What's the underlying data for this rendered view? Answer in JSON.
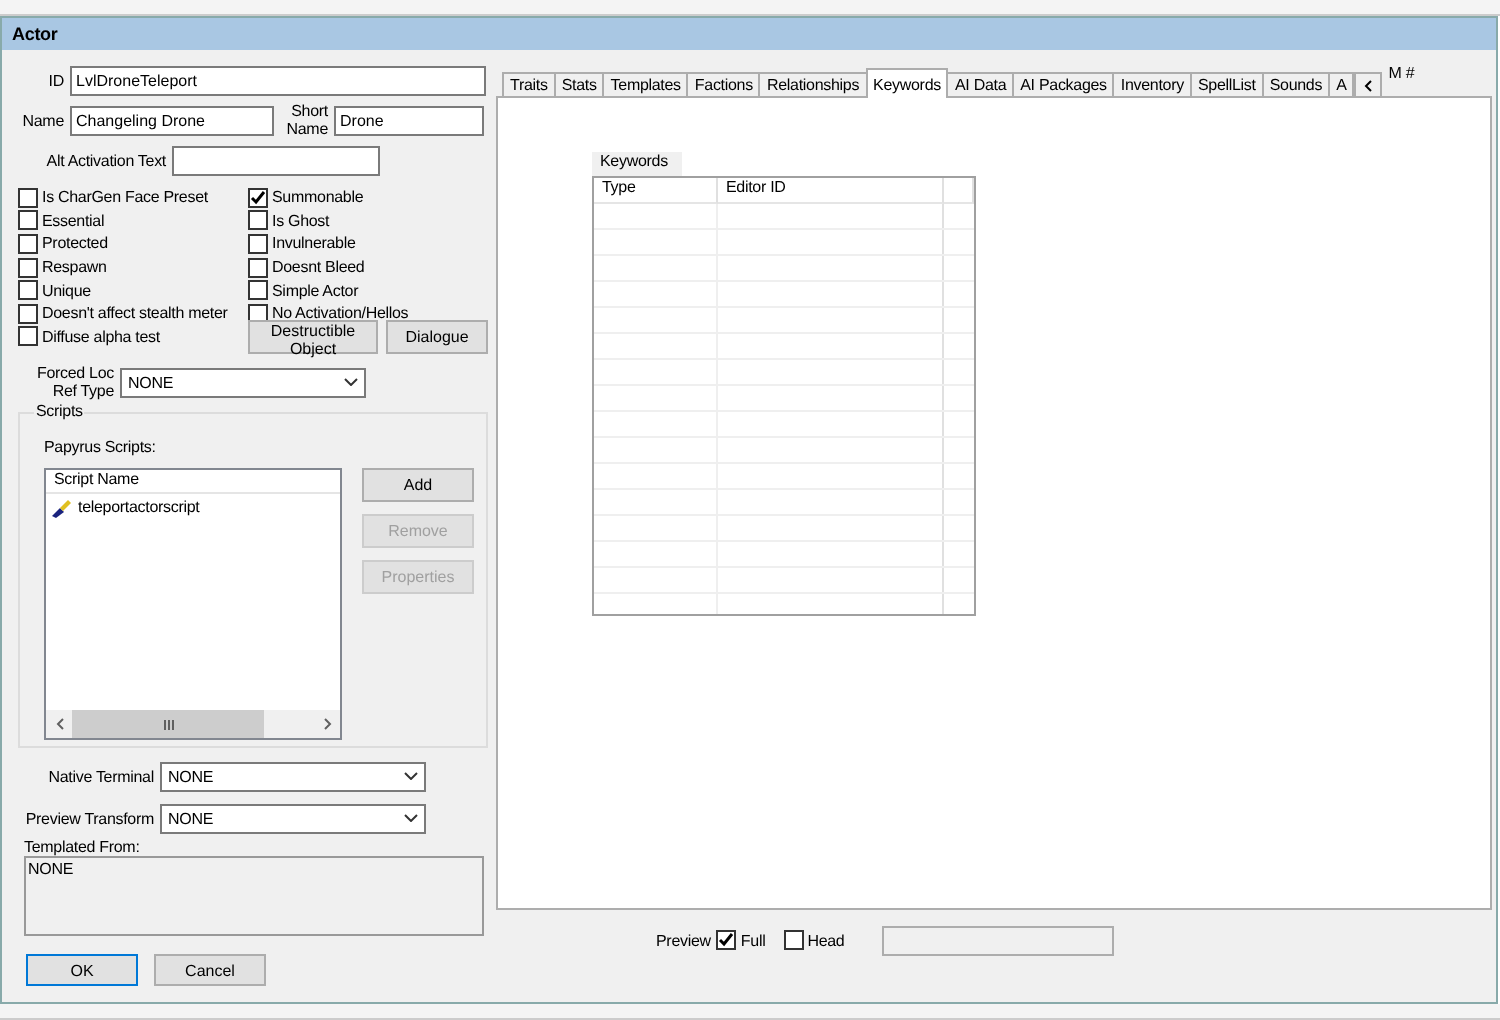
{
  "window": {
    "title": "Actor"
  },
  "fields": {
    "id": {
      "label": "ID",
      "value": "LvlDroneTeleport"
    },
    "name": {
      "label": "Name",
      "value": "Changeling Drone"
    },
    "short_name": {
      "label": "Short Name",
      "value": "Drone"
    },
    "alt_activation": {
      "label": "Alt Activation Text"
    }
  },
  "flags_left": [
    {
      "label": "Is CharGen Face Preset",
      "checked": false
    },
    {
      "label": "Essential",
      "checked": false
    },
    {
      "label": "Protected",
      "checked": false
    },
    {
      "label": "Respawn",
      "checked": false
    },
    {
      "label": "Unique",
      "checked": false
    },
    {
      "label": "Doesn't affect stealth meter",
      "checked": false
    },
    {
      "label": "Diffuse alpha test",
      "checked": false
    }
  ],
  "flags_right": [
    {
      "label": "Summonable",
      "checked": true
    },
    {
      "label": "Is Ghost",
      "checked": false
    },
    {
      "label": "Invulnerable",
      "checked": false
    },
    {
      "label": "Doesnt Bleed",
      "checked": false
    },
    {
      "label": "Simple Actor",
      "checked": false
    },
    {
      "label": "No Activation/Hellos",
      "checked": false
    }
  ],
  "object_buttons": [
    "Destructible Object",
    "Dialogue"
  ],
  "forced_loc": {
    "label": "Forced Loc Ref Type",
    "value": "NONE"
  },
  "scripts": {
    "group_title": "Scripts",
    "list_label": "Papyrus Scripts:",
    "column": "Script Name",
    "items": [
      "teleportactorscript"
    ],
    "buttons": [
      {
        "label": "Add",
        "disabled": false
      },
      {
        "label": "Remove",
        "disabled": true
      },
      {
        "label": "Properties",
        "disabled": true
      }
    ]
  },
  "native_terminal": {
    "label": "Native Terminal",
    "value": "NONE"
  },
  "preview_transform": {
    "label": "Preview Transform",
    "value": "NONE"
  },
  "templated_from": {
    "label": "Templated From:",
    "value": "NONE"
  },
  "dialog_buttons": [
    "OK",
    "Cancel"
  ],
  "tabs": [
    {
      "label": "Traits",
      "selected": false
    },
    {
      "label": "Stats",
      "selected": false
    },
    {
      "label": "Templates",
      "selected": false
    },
    {
      "label": "Factions",
      "selected": false
    },
    {
      "label": "Relationships",
      "selected": false
    },
    {
      "label": "Keywords",
      "selected": true
    },
    {
      "label": "AI Data",
      "selected": false
    },
    {
      "label": "AI Packages",
      "selected": false
    },
    {
      "label": "Inventory",
      "selected": false
    },
    {
      "label": "SpellList",
      "selected": false
    },
    {
      "label": "Sounds",
      "selected": false
    },
    {
      "label": "A",
      "selected": false
    }
  ],
  "behind_label": "M #",
  "keywords": {
    "title": "Keywords",
    "columns": [
      "Type",
      "Editor ID"
    ]
  },
  "preview": {
    "label": "Preview",
    "options": [
      {
        "label": "Full",
        "checked": true
      },
      {
        "label": "Head",
        "checked": false
      }
    ]
  }
}
